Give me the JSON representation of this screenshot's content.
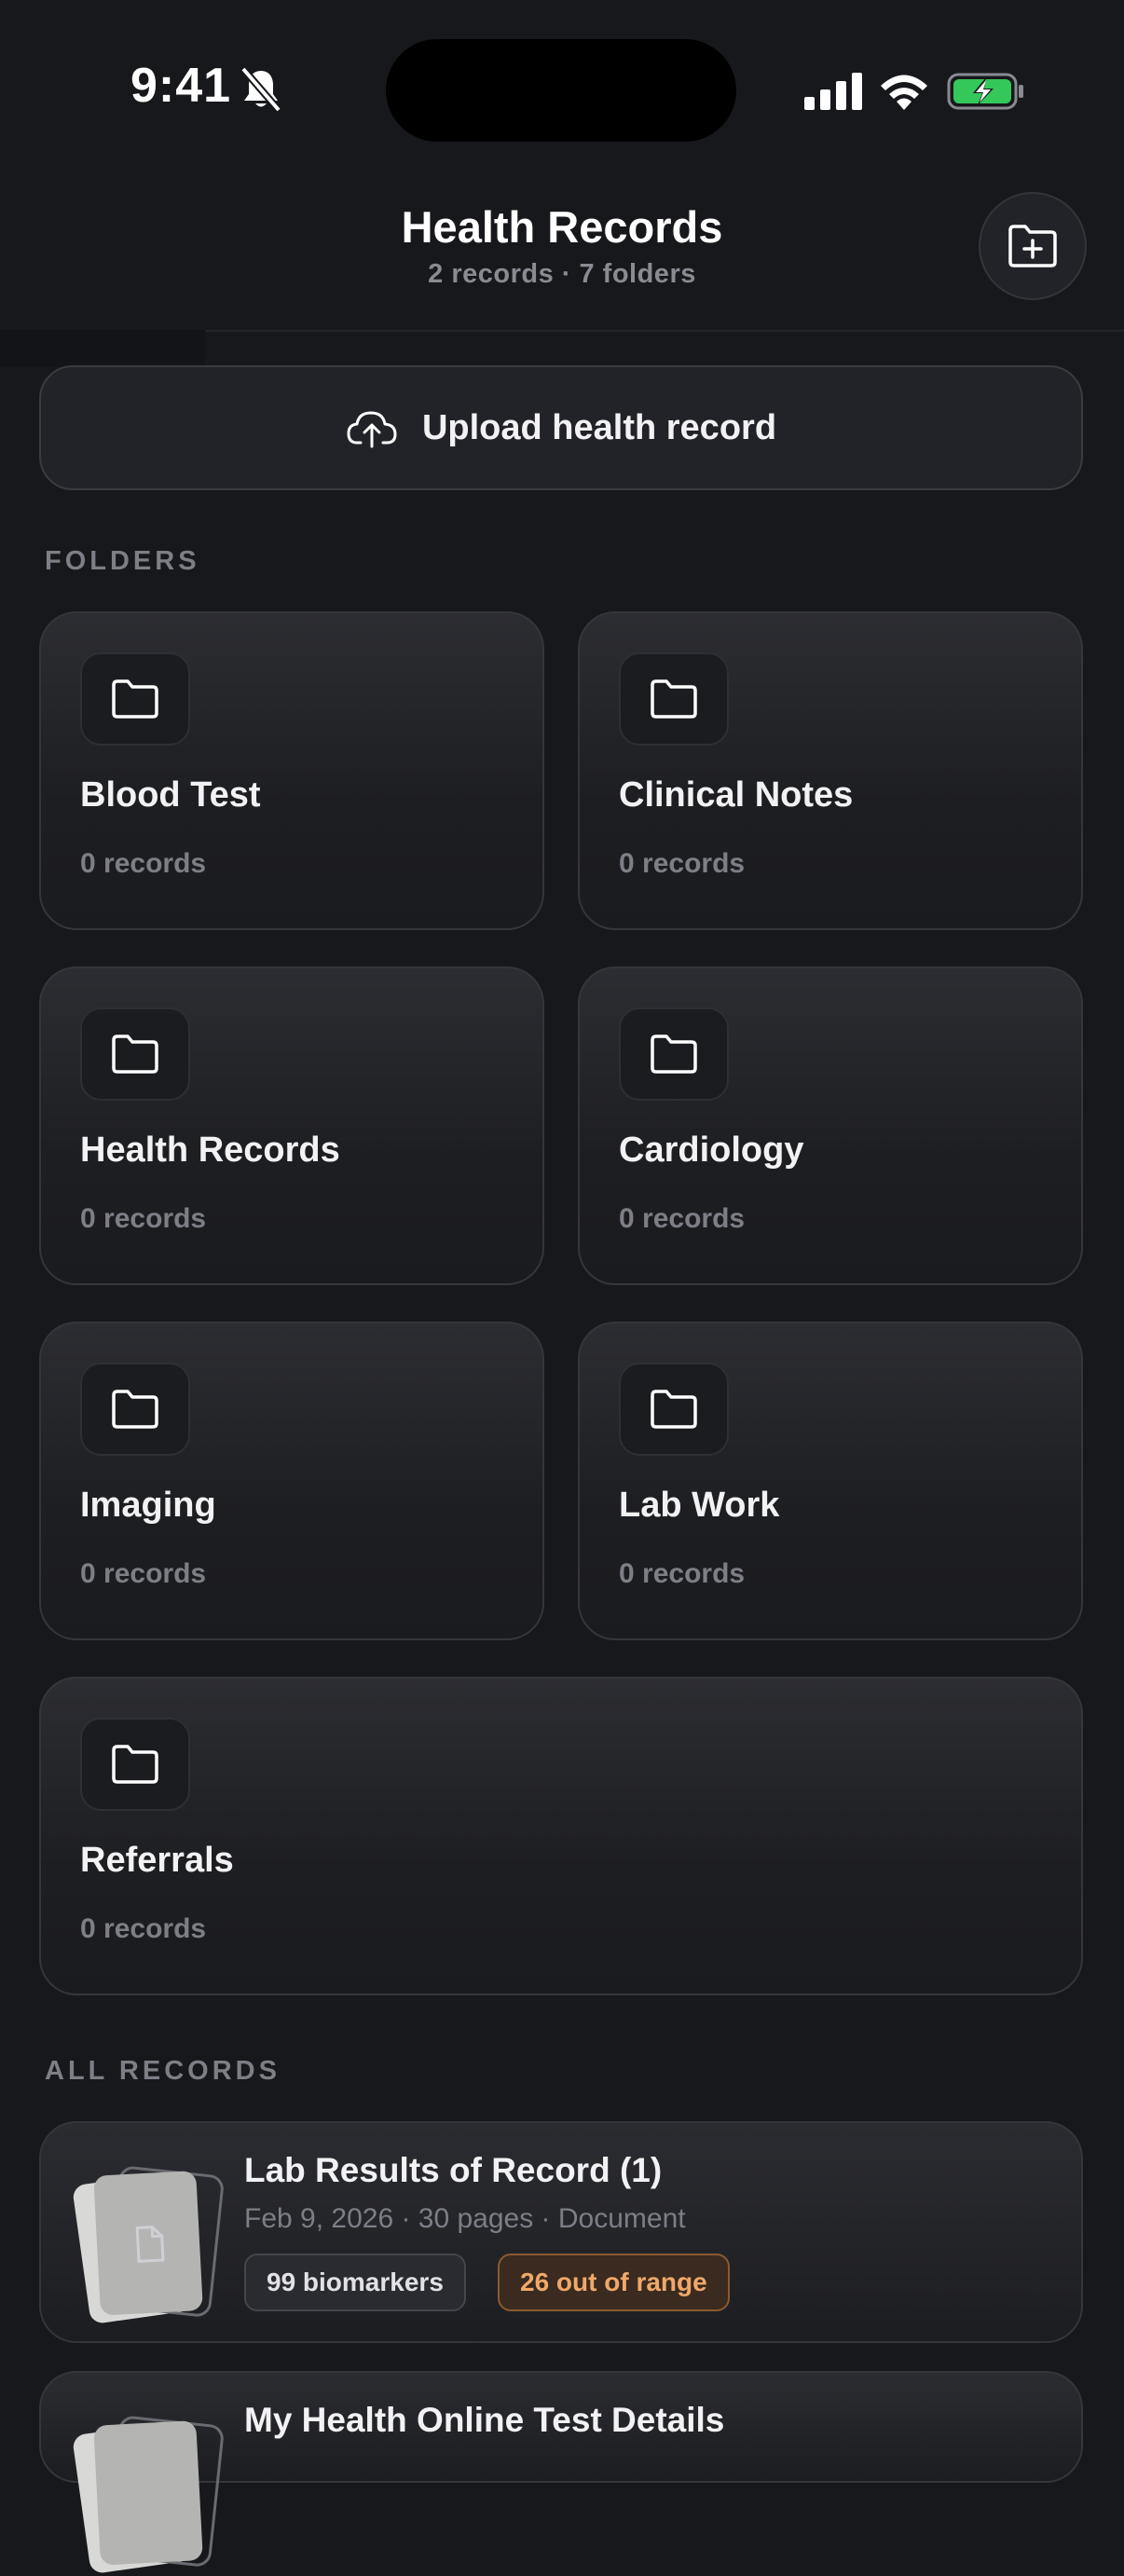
{
  "status_bar": {
    "time": "9:41"
  },
  "header": {
    "title": "Health Records",
    "subtitle": "2 records · 7 folders"
  },
  "upload": {
    "label": "Upload health record"
  },
  "sections": {
    "folders": "FOLDERS",
    "all_records": "ALL RECORDS"
  },
  "folders": [
    {
      "name": "Blood Test",
      "count": "0 records"
    },
    {
      "name": "Clinical Notes",
      "count": "0 records"
    },
    {
      "name": "Health Records",
      "count": "0 records"
    },
    {
      "name": "Cardiology",
      "count": "0 records"
    },
    {
      "name": "Imaging",
      "count": "0 records"
    },
    {
      "name": "Lab Work",
      "count": "0 records"
    },
    {
      "name": "Referrals",
      "count": "0 records"
    }
  ],
  "records": [
    {
      "title": "Lab Results of Record (1)",
      "meta": "Feb 9, 2026 · 30 pages · Document",
      "chips": {
        "biomarkers": "99 biomarkers",
        "out_of_range": "26 out of range"
      }
    },
    {
      "title": "My Health Online Test Details"
    }
  ],
  "icons": {
    "bell": "bell-slash-icon",
    "folder": "folder-icon",
    "new_folder": "folder-plus-icon",
    "upload": "cloud-upload-icon",
    "document": "document-icon"
  },
  "colors": {
    "background": "#17181c",
    "accent_warning": "#f0a86a",
    "battery": "#34c759"
  }
}
